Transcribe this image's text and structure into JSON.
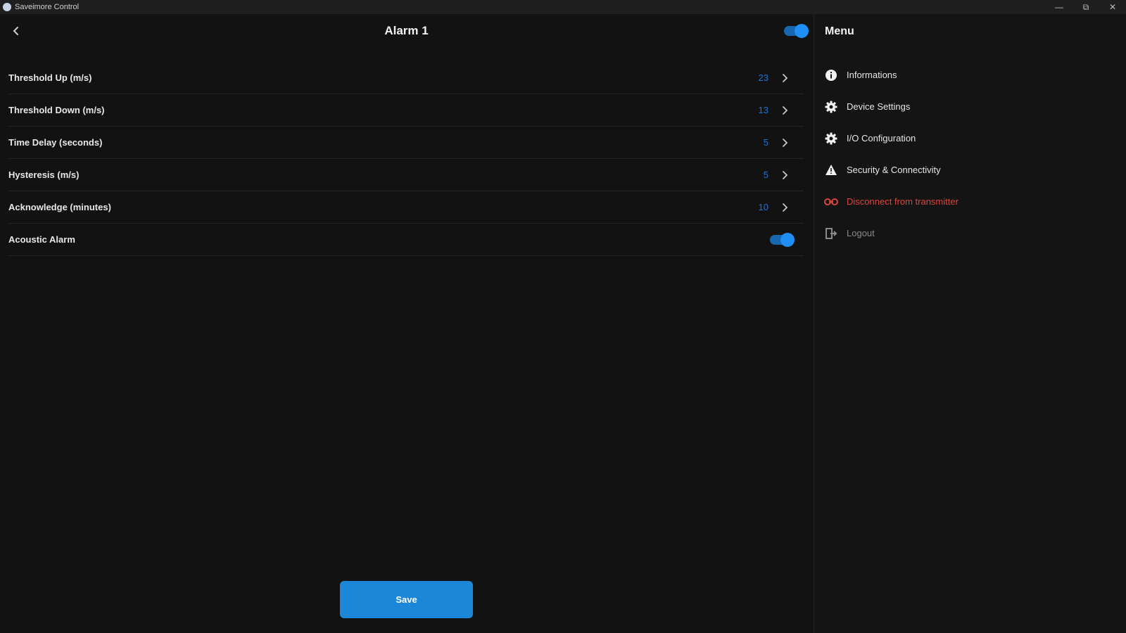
{
  "window": {
    "title": "Saveimore Control",
    "minimize_glyph": "—",
    "maximize_glyph": "⧉",
    "close_glyph": "✕"
  },
  "header": {
    "title": "Alarm 1",
    "enabled": true
  },
  "settings": [
    {
      "label": "Threshold Up (m/s)",
      "value": "23",
      "type": "chevron"
    },
    {
      "label": "Threshold Down (m/s)",
      "value": "13",
      "type": "chevron"
    },
    {
      "label": "Time Delay (seconds)",
      "value": "5",
      "type": "chevron"
    },
    {
      "label": "Hysteresis (m/s)",
      "value": "5",
      "type": "chevron"
    },
    {
      "label": "Acknowledge (minutes)",
      "value": "10",
      "type": "chevron"
    },
    {
      "label": "Acoustic Alarm",
      "value": "",
      "type": "toggle"
    }
  ],
  "save_label": "Save",
  "sidebar": {
    "title": "Menu",
    "items": [
      {
        "label": "Informations",
        "icon": "info-icon"
      },
      {
        "label": "Device Settings",
        "icon": "gear-icon"
      },
      {
        "label": "I/O Configuration",
        "icon": "gear-icon"
      },
      {
        "label": "Security & Connectivity",
        "icon": "warning-icon"
      },
      {
        "label": "Disconnect from transmitter",
        "icon": "unlink-icon"
      },
      {
        "label": "Logout",
        "icon": "logout-icon"
      }
    ]
  },
  "colors": {
    "accent": "#1c87d9",
    "value": "#1c74d6",
    "danger": "#d9463c",
    "background": "#121212"
  }
}
